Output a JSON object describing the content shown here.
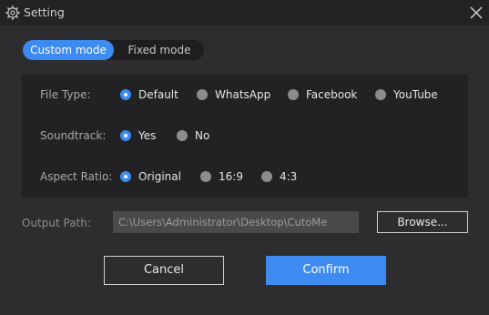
{
  "window": {
    "title": "Setting",
    "title_icon": "gear-icon",
    "close_icon": "close-icon"
  },
  "mode_toggle": {
    "tabs": [
      {
        "label": "Custom mode",
        "selected": true
      },
      {
        "label": "Fixed mode",
        "selected": false
      }
    ]
  },
  "options": {
    "file_type": {
      "label": "File Type:",
      "choices": [
        {
          "label": "Default",
          "selected": true
        },
        {
          "label": "WhatsApp",
          "selected": false
        },
        {
          "label": "Facebook",
          "selected": false
        },
        {
          "label": "YouTube",
          "selected": false
        }
      ]
    },
    "soundtrack": {
      "label": "Soundtrack:",
      "choices": [
        {
          "label": "Yes",
          "selected": true
        },
        {
          "label": "No",
          "selected": false
        }
      ]
    },
    "aspect_ratio": {
      "label": "Aspect Ratio:",
      "choices": [
        {
          "label": "Original",
          "selected": true
        },
        {
          "label": "16:9",
          "selected": false
        },
        {
          "label": "4:3",
          "selected": false
        }
      ]
    }
  },
  "output": {
    "label": "Output Path:",
    "value": "C:\\Users\\Administrator\\Desktop\\CutoMe",
    "browse_label": "Browse..."
  },
  "actions": {
    "cancel_label": "Cancel",
    "confirm_label": "Confirm"
  },
  "colors": {
    "accent": "#3d8bf0",
    "background": "#2d2d30",
    "panel": "#222225"
  }
}
